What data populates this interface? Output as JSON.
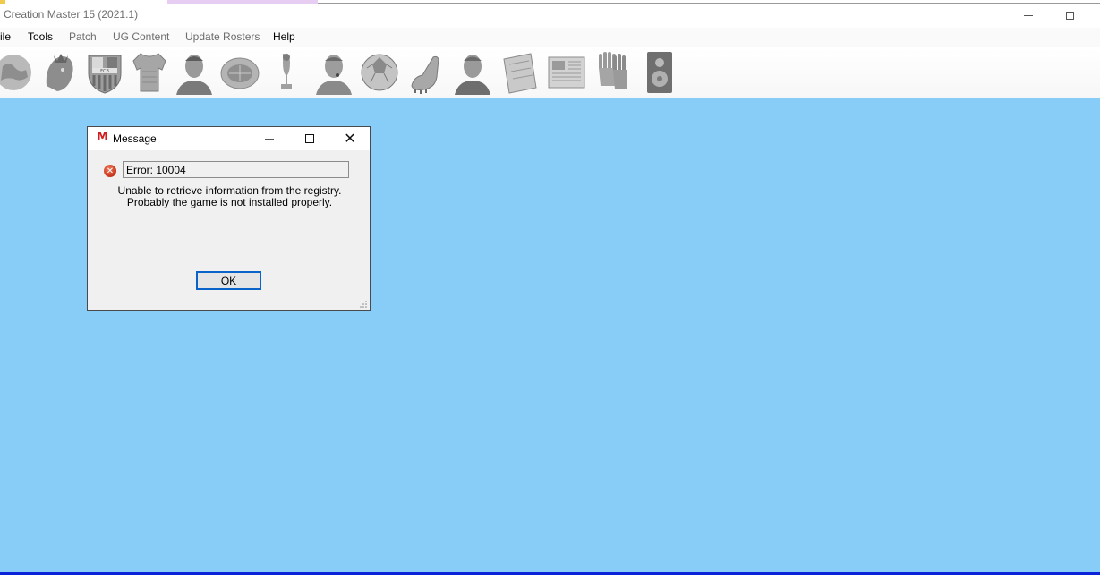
{
  "window": {
    "title": "Creation Master 15 (2021.1)"
  },
  "menu": [
    {
      "label": "ile",
      "enabled": true
    },
    {
      "label": "Tools",
      "enabled": true
    },
    {
      "label": "Patch",
      "enabled": false
    },
    {
      "label": "UG Content",
      "enabled": false
    },
    {
      "label": "Update Rosters",
      "enabled": false
    },
    {
      "label": "Help",
      "enabled": true
    }
  ],
  "toolbar": {
    "icons": [
      "globe-icon",
      "lion-crest-icon",
      "club-crest-icon",
      "jersey-icon",
      "player-icon",
      "stadium-icon",
      "trophy-icon",
      "referee-icon",
      "ball-icon",
      "boot-icon",
      "manager-icon",
      "tactics-board-icon",
      "newspaper-icon",
      "gloves-icon",
      "speaker-icon"
    ]
  },
  "dialog": {
    "logo": "M",
    "title": "Message",
    "error_code": "Error: 10004",
    "message": "Unable to retrieve information from the registry. Probably the game is not installed properly.",
    "ok_label": "OK"
  },
  "colors": {
    "workspace": "#87cdf8",
    "status_line": "#0a22d8",
    "ok_border": "#0a63c9",
    "logo": "#d11f1f"
  }
}
